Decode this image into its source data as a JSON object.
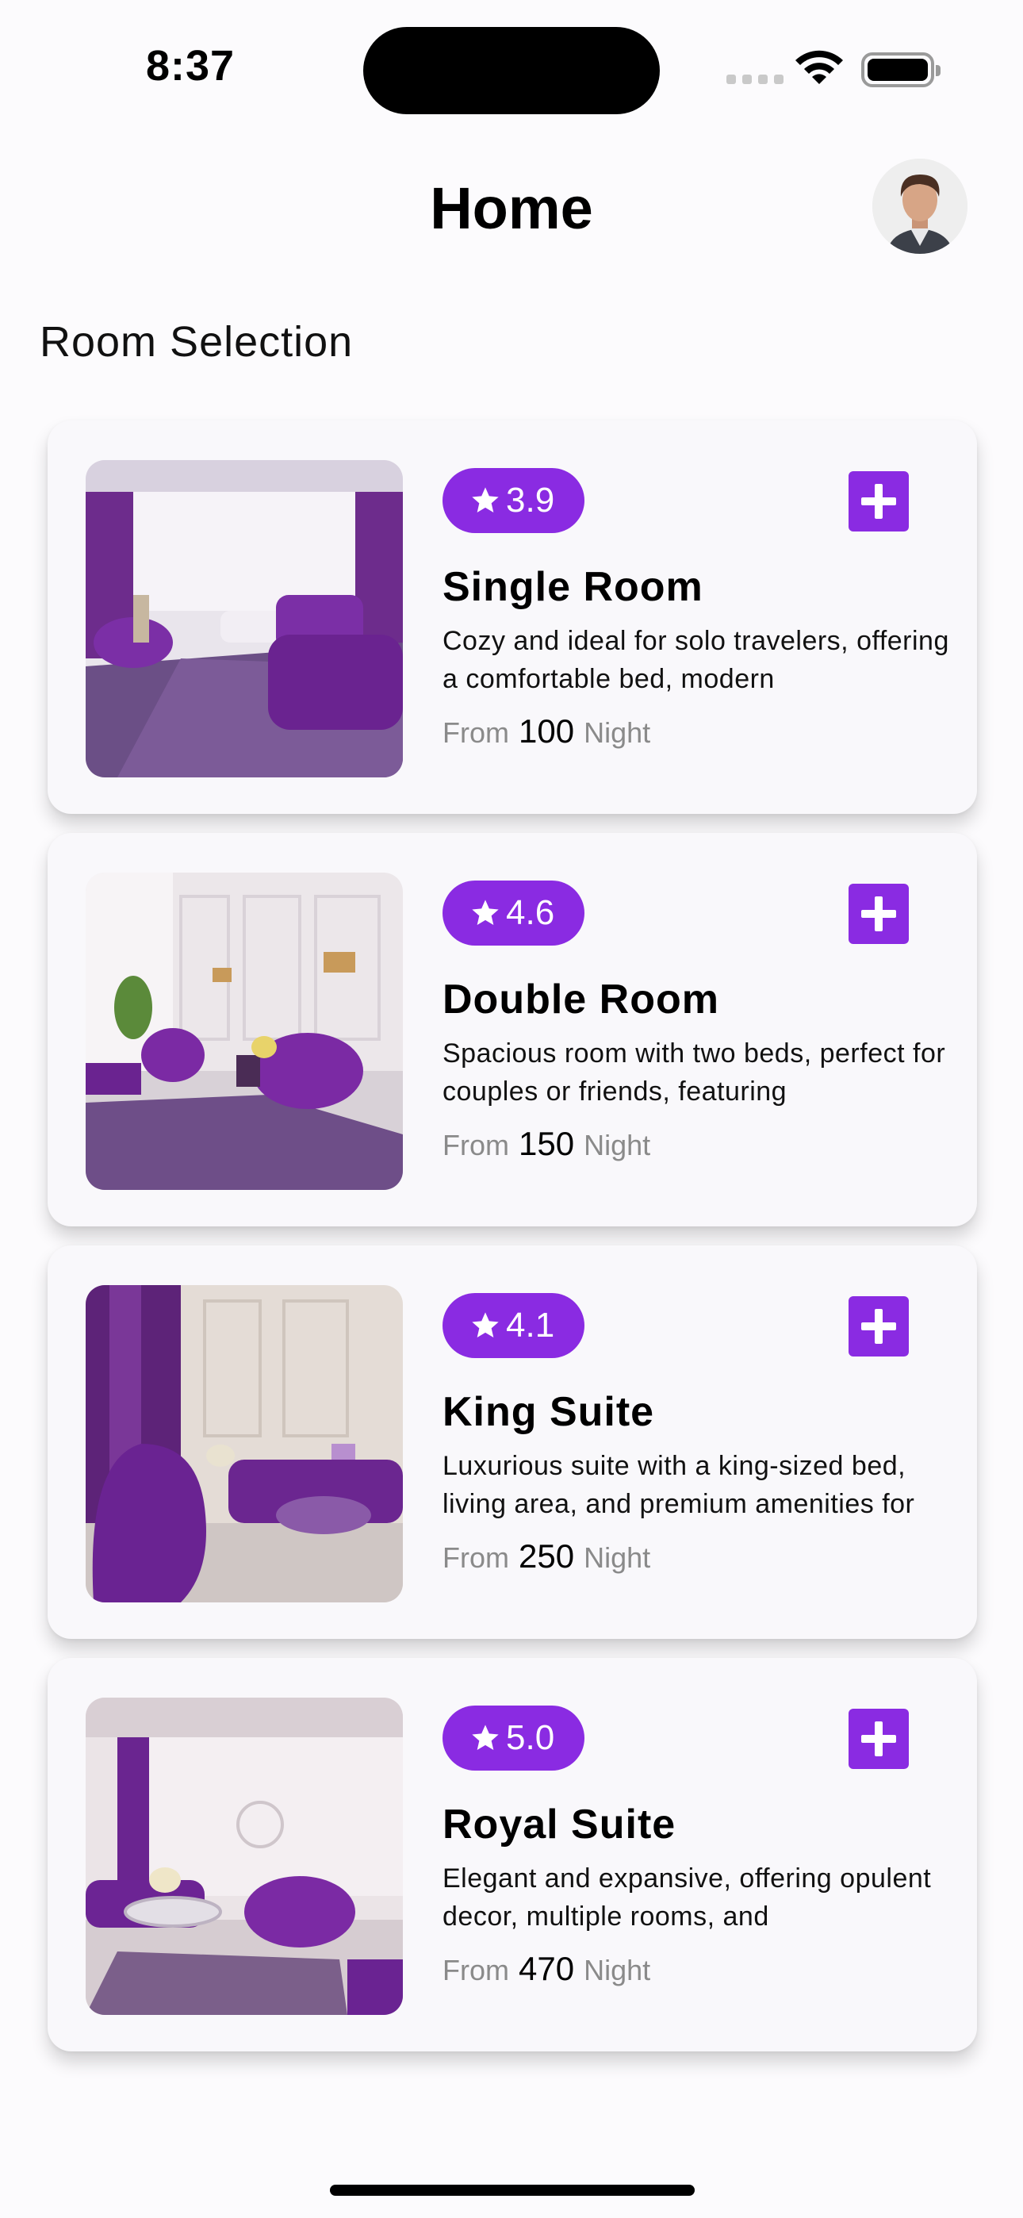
{
  "status_bar": {
    "time": "8:37"
  },
  "header": {
    "title": "Home",
    "avatar_icon": "user-avatar"
  },
  "section": {
    "title": "Room Selection"
  },
  "accent_color": "#8a2be2",
  "rooms": [
    {
      "rating": "3.9",
      "name": "Single Room",
      "description": "Cozy and ideal for solo travelers, offering a comfortable bed, modern",
      "price_prefix": "From",
      "price": "100",
      "price_unit": "Night"
    },
    {
      "rating": "4.6",
      "name": "Double Room",
      "description": "Spacious room with two beds, perfect for couples or friends, featuring",
      "price_prefix": "From",
      "price": "150",
      "price_unit": "Night"
    },
    {
      "rating": "4.1",
      "name": "King Suite",
      "description": "Luxurious suite with a king-sized bed, living area, and premium amenities for",
      "price_prefix": "From",
      "price": "250",
      "price_unit": "Night"
    },
    {
      "rating": "5.0",
      "name": "Royal Suite",
      "description": "Elegant and expansive, offering opulent decor, multiple rooms, and",
      "price_prefix": "From",
      "price": "470",
      "price_unit": "Night"
    }
  ]
}
